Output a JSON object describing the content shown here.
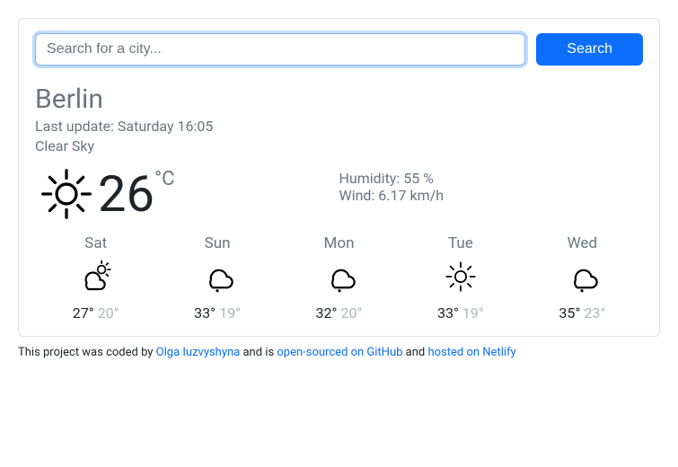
{
  "search": {
    "placeholder": "Search for a city...",
    "button": "Search"
  },
  "city": "Berlin",
  "last_update_label": "Last update:",
  "last_update_value": "Saturday 16:05",
  "description": "Clear Sky",
  "temperature": "26",
  "unit": "°C",
  "humidity_label": "Humidity:",
  "humidity_value": "55 %",
  "wind_label": "Wind:",
  "wind_value": "6.17 km/h",
  "forecast": [
    {
      "day": "Sat",
      "icon": "partly-cloudy",
      "hi": "27°",
      "lo": "20°"
    },
    {
      "day": "Sun",
      "icon": "rain",
      "hi": "33°",
      "lo": "19°"
    },
    {
      "day": "Mon",
      "icon": "rain",
      "hi": "32°",
      "lo": "20°"
    },
    {
      "day": "Tue",
      "icon": "sun",
      "hi": "33°",
      "lo": "19°"
    },
    {
      "day": "Wed",
      "icon": "rain",
      "hi": "35°",
      "lo": "23°"
    }
  ],
  "footer": {
    "prefix": "This project was coded by ",
    "author": "Olga Iuzvyshyna",
    "mid1": " and is ",
    "link1": "open-sourced on GitHub",
    "mid2": " and ",
    "link2": "hosted on Netlify"
  }
}
